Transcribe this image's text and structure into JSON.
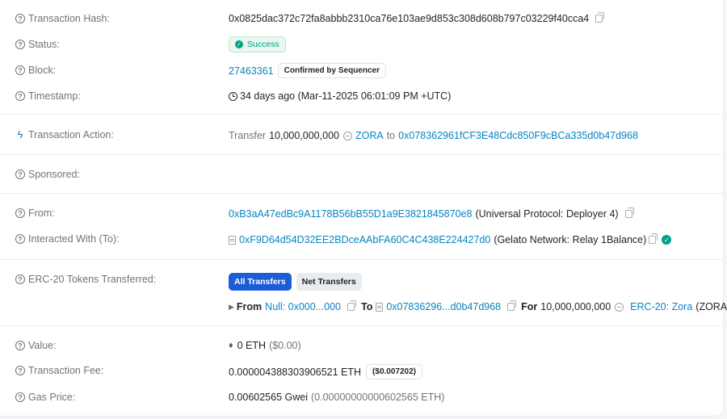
{
  "rows": {
    "tx_hash": {
      "label": "Transaction Hash:",
      "value": "0x0825dac372c72fa8abbb2310ca76e103ae9d853c308d608b797c03229f40cca4"
    },
    "status": {
      "label": "Status:",
      "value": "Success"
    },
    "block": {
      "label": "Block:",
      "number": "27463361",
      "badge": "Confirmed by Sequencer"
    },
    "timestamp": {
      "label": "Timestamp:",
      "value": "34 days ago (Mar-11-2025 06:01:09 PM +UTC)"
    },
    "action": {
      "label": "Transaction Action:",
      "prefix": "Transfer",
      "amount": "10,000,000,000",
      "token": "ZORA",
      "to_word": "to",
      "to_address": "0x078362961fCF3E48Cdc850F9cBCa335d0b47d968"
    },
    "sponsored": {
      "label": "Sponsored:"
    },
    "from": {
      "label": "From:",
      "address": "0xB3aA47edBc9A1178B56bB55D1a9E3821845870e8",
      "name": "(Universal Protocol: Deployer 4)"
    },
    "interacted": {
      "label": "Interacted With (To):",
      "address": "0xF9D64d54D32EE2BDceAAbFA60C4C438E224427d0",
      "name": "(Gelato Network: Relay 1Balance)"
    },
    "erc20": {
      "label": "ERC-20 Tokens Transferred:",
      "tab_all": "All Transfers",
      "tab_net": "Net Transfers",
      "from_word": "From",
      "from_value": "Null: 0x000...000",
      "to_word": "To",
      "to_value": "0x07836296...d0b47d968",
      "for_word": "For",
      "amount": "10,000,000,000",
      "token_name": "ERC-20: Zora",
      "token_symbol": "(ZORA)"
    },
    "value": {
      "label": "Value:",
      "eth": "0 ETH",
      "usd": "($0.00)"
    },
    "fee": {
      "label": "Transaction Fee:",
      "eth": "0.000004388303906521 ETH",
      "usd": "($0.007202)"
    },
    "gas": {
      "label": "Gas Price:",
      "gwei": "0.00602565 Gwei",
      "eth": "(0.00000000000602565 ETH)"
    }
  },
  "icons": {
    "help": "question-circle-icon",
    "action": "lightning-icon",
    "copy": "copy-icon",
    "token": "token-icon",
    "contract": "file-icon",
    "verified": "check-circle-icon",
    "clock": "clock-icon",
    "eth": "ethereum-icon"
  },
  "colors": {
    "link": "#0784c3",
    "success": "#00a186",
    "tab_active": "#1c5cd6",
    "label": "#6c757d"
  }
}
